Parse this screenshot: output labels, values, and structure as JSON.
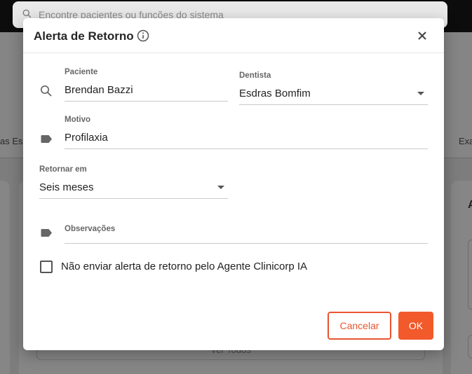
{
  "background": {
    "search_placeholder": "Encontre pacientes ou funções do sistema",
    "tab_left_fragment": "as Es",
    "tab_right_fragment": "Exa",
    "card_right_heading_fragment": "A",
    "ver_todos": "Ver Todos"
  },
  "modal": {
    "title": "Alerta de Retorno",
    "paciente": {
      "label": "Paciente",
      "value": "Brendan Bazzi"
    },
    "dentista": {
      "label": "Dentista",
      "value": "Esdras Bomfim"
    },
    "motivo": {
      "label": "Motivo",
      "value": "Profilaxia"
    },
    "retornar": {
      "label": "Retornar em",
      "value": "Seis meses"
    },
    "observacoes": {
      "label": "Observações",
      "value": ""
    },
    "checkbox": {
      "label": "Não enviar alerta de retorno pelo Agente Clinicorp IA",
      "checked": false
    },
    "cancel_label": "Cancelar",
    "ok_label": "OK"
  },
  "colors": {
    "accent": "#f25a2b",
    "overlay": "#7d7d7d",
    "text": "#222222"
  }
}
